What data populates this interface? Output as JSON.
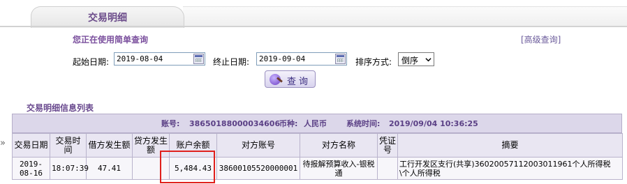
{
  "tab": {
    "title": "交易明细"
  },
  "query": {
    "mode_label": "您正在使用简单查询",
    "advanced_link": "[高级查询]",
    "start_label": "起始日期:",
    "start_value": "2019-08-04",
    "end_label": "终止日期:",
    "end_value": "2019-09-04",
    "sort_label": "排序方式:",
    "sort_value": "倒序",
    "button_label": "查询"
  },
  "list": {
    "title": "交易明细信息列表",
    "account_label": "账号:",
    "account_value": "38650188000034606",
    "currency_label": "币种:",
    "currency_value": "人民币",
    "systime_label": "系统时间:",
    "systime_value": "2019/09/04 10:36:25",
    "columns": [
      "交易日期",
      "交易时间",
      "借方发生额",
      "贷方发生额",
      "账户余额",
      "对方账号",
      "对方名称",
      "凭证号",
      "摘要"
    ],
    "rows": [
      {
        "date": "2019-08-16",
        "time": "18:07:39",
        "debit": "47.41",
        "credit": "",
        "balance": "5,484.43",
        "counter_account": "38600105520000001",
        "counter_name": "待报解预算收入-银税通",
        "voucher": "",
        "summary": "工行开发区支行(共享)36020057112003011961个人所得税\\个人所得税"
      }
    ]
  },
  "icons": {
    "calendar": "calendar-icon",
    "query": "globe-search-icon",
    "dropdown": "chevron-down-icon"
  },
  "colors": {
    "accent": "#6b4b8a",
    "header_bg": "#dcd7ea",
    "highlight": "#e0201c"
  }
}
